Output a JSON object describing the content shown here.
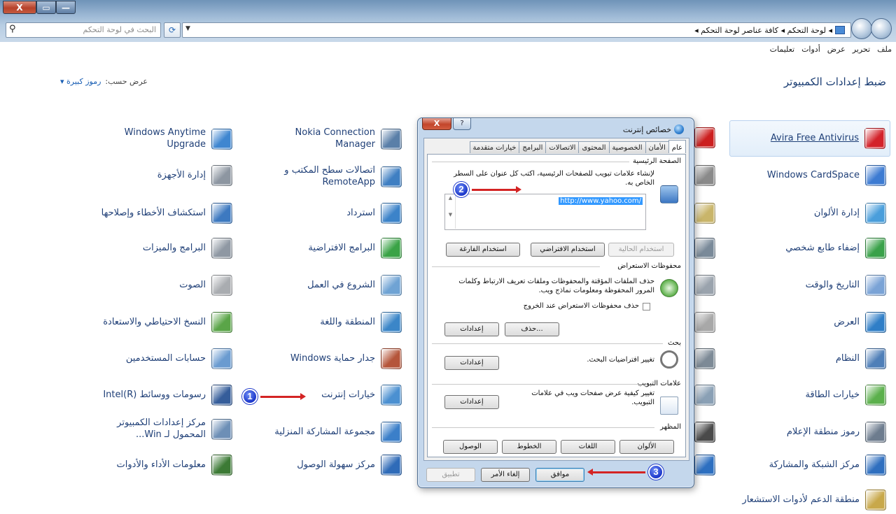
{
  "window": {
    "close_label": "X",
    "restore_label": "▭",
    "minimize_label": "—"
  },
  "addressbar": {
    "search_placeholder": "البحث في لوحة التحكم",
    "breadcrumb": "◂ لوحة التحكم ◂ كافة عناصر لوحة التحكم ◂",
    "refresh_icon": "⟳",
    "search_icon": "⚲"
  },
  "menu": [
    "ملف",
    "تحرير",
    "عرض",
    "أدوات",
    "تعليمات"
  ],
  "page": {
    "title": "ضبط إعدادات الكمبيوتر",
    "view_by_label": "عرض حسب:",
    "view_by_value": "رموز كبيرة ▾"
  },
  "col1": [
    {
      "label": "Avira Free Antivirus",
      "color": "#d3222a",
      "icon": "avira-icon"
    },
    {
      "label": "Windows CardSpace",
      "color": "#3d7bd2",
      "icon": "cardspace-icon"
    },
    {
      "label": "إدارة الألوان",
      "color": "#4a9edb",
      "icon": "color-management-icon"
    },
    {
      "label": "إضفاء طابع شخصي",
      "color": "#3aa14a",
      "icon": "personalization-icon"
    },
    {
      "label": "التاريخ والوقت",
      "color": "#7aa3d6",
      "icon": "clock-icon"
    },
    {
      "label": "العرض",
      "color": "#2f7ec7",
      "icon": "display-icon"
    },
    {
      "label": "النظام",
      "color": "#4f7fb8",
      "icon": "system-icon"
    },
    {
      "label": "خيارات الطاقة",
      "color": "#5bb04c",
      "icon": "power-icon"
    },
    {
      "label": "رموز منطقة الإعلام",
      "color": "#6d7c8e",
      "icon": "notification-icon"
    },
    {
      "label": "مركز الشبكة والمشاركة",
      "color": "#2f6fbf",
      "icon": "network-icon"
    },
    {
      "label": "منطقة الدعم لأدوات الاستشعار",
      "color": "#c8a84a",
      "icon": "sensor-icon"
    }
  ],
  "col2": [
    {
      "color": "#cc1f1f",
      "icon": "flash-icon"
    },
    {
      "color": "#8a8a8a",
      "icon": "firewall-wall-icon"
    },
    {
      "color": "#c9b56a",
      "icon": "phone-modem-icon"
    },
    {
      "color": "#7a8a99",
      "icon": "printers-icon"
    },
    {
      "color": "#9aa3ad",
      "icon": "microphone-icon"
    },
    {
      "color": "#a8a8a8",
      "icon": "mouse-icon"
    },
    {
      "color": "#7d8a96",
      "icon": "phone-icon"
    },
    {
      "color": "#8aa0b5",
      "icon": "users-search-icon"
    },
    {
      "color": "#4a4a4a",
      "icon": "tower-icon"
    },
    {
      "color": "#2d6fc0",
      "icon": "flag-icon"
    }
  ],
  "col3": [
    {
      "label": "Nokia Connection Manager",
      "color": "#5a7fa8",
      "icon": "nokia-icon"
    },
    {
      "label": "اتصالات سطح المكتب و RemoteApp",
      "color": "#3f7fc2",
      "icon": "remoteapp-icon"
    },
    {
      "label": "استرداد",
      "color": "#3c83c9",
      "icon": "recovery-icon"
    },
    {
      "label": "البرامج الافتراضية",
      "color": "#3aa346",
      "icon": "default-programs-icon"
    },
    {
      "label": "الشروع في العمل",
      "color": "#6fa3d4",
      "icon": "getting-started-icon"
    },
    {
      "label": "المنطقة واللغة",
      "color": "#3b86c8",
      "icon": "region-language-icon"
    },
    {
      "label": "جدار حماية Windows",
      "color": "#b5553a",
      "icon": "firewall-icon"
    },
    {
      "label": "خيارات إنترنت",
      "color": "#4b90d1",
      "icon": "internet-options-icon"
    },
    {
      "label": "مجموعة المشاركة المنزلية",
      "color": "#3b7fc9",
      "icon": "homegroup-icon"
    },
    {
      "label": "مركز سهولة الوصول",
      "color": "#2f6bb8",
      "icon": "ease-of-access-icon"
    }
  ],
  "col4": [
    {
      "label": "Windows Anytime Upgrade",
      "color": "#3f86d0",
      "icon": "windows-logo-icon"
    },
    {
      "label": "إدارة الأجهزة",
      "color": "#8d96a1",
      "icon": "device-manager-icon"
    },
    {
      "label": "استكشاف الأخطاء وإصلاحها",
      "color": "#3d79c0",
      "icon": "troubleshooting-icon"
    },
    {
      "label": "البرامج والميزات",
      "color": "#8f98a3",
      "icon": "programs-icon"
    },
    {
      "label": "الصوت",
      "color": "#a9acb0",
      "icon": "sound-icon"
    },
    {
      "label": "النسخ الاحتياطي والاستعادة",
      "color": "#5aa548",
      "icon": "backup-icon"
    },
    {
      "label": "حسابات المستخدمين",
      "color": "#6a9bd0",
      "icon": "user-accounts-icon"
    },
    {
      "label": "رسومات ووسائط Intel(R)",
      "color": "#355d9a",
      "icon": "intel-graphics-icon"
    },
    {
      "label": "مركز إعدادات الكمبيوتر المحمول لـ Win...",
      "color": "#6d8fb6",
      "icon": "mobility-center-icon"
    },
    {
      "label": "معلومات الأداء والأدوات",
      "color": "#3c7a35",
      "icon": "performance-icon"
    }
  ],
  "dialog": {
    "title": "خصائص إنترنت",
    "close_label": "X",
    "help_label": "?",
    "tabs": [
      "عام",
      "الأمان",
      "الخصوصية",
      "المحتوى",
      "الاتصالات",
      "البرامج",
      "خيارات متقدمة"
    ],
    "home": {
      "group": "الصفحة الرئيسية",
      "desc": "لإنشاء علامات تبويب للصفحات الرئيسية، اكتب كل عنوان على السطر الخاص به.",
      "url": "http://www.yahoo.com/",
      "use_current": "استخدام الحالية",
      "use_default": "استخدام الافتراضي",
      "use_blank": "استخدام الفارغة"
    },
    "history": {
      "group": "محفوظات الاستعراض",
      "desc": "حذف الملفات المؤقتة والمحفوظات وملفات تعريف الارتباط وكلمات المرور المحفوظة ومعلومات نماذج ويب.",
      "checkbox": "حذف محفوظات الاستعراض عند الخروج",
      "delete": "حذف...",
      "settings": "إعدادات"
    },
    "search": {
      "group": "بحث",
      "desc": "تغيير افتراضيات البحث.",
      "settings": "إعدادات"
    },
    "tabsgrp": {
      "group": "علامات التبويب",
      "desc": "تغيير كيفية عرض صفحات ويب في علامات التبويب.",
      "settings": "إعدادات"
    },
    "appearance": {
      "group": "المظهر",
      "colors": "الألوان",
      "languages": "اللغات",
      "fonts": "الخطوط",
      "accessibility": "الوصول"
    },
    "ok": "موافق",
    "cancel": "إلغاء الأمر",
    "apply": "تطبيق"
  },
  "callouts": [
    "1",
    "2",
    "3"
  ]
}
